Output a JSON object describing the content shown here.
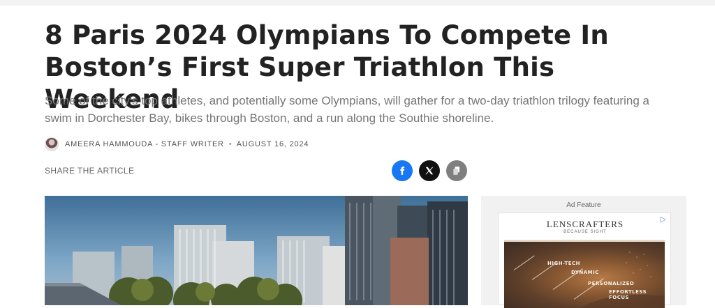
{
  "article": {
    "title": "8 Paris 2024 Olympians To Compete In Boston’s First Super Triathlon This Weekend",
    "subtitle": "Some of the city's top athletes, and potentially some Olympians, will gather for a two-day triathlon trilogy featuring a swim in Dorchester Bay, bikes through Boston, and a run along the Southie shoreline.",
    "author": "AMEERA HAMMOUDA - STAFF WRITER",
    "date": "AUGUST 16, 2024",
    "separator": "•"
  },
  "share": {
    "label": "SHARE THE ARTICLE",
    "buttons": [
      {
        "name": "facebook",
        "icon": "facebook-icon",
        "color": "#1877f2"
      },
      {
        "name": "x",
        "icon": "x-icon",
        "color": "#111111"
      },
      {
        "name": "copy-link",
        "icon": "copy-icon",
        "color": "#7f7f7f"
      }
    ]
  },
  "ad": {
    "label": "Ad Feature",
    "brand": "LENSCRAFTERS",
    "tagline": "BECAUSE SIGHT",
    "features": [
      "HIGH-TECH",
      "DYNAMIC",
      "PERSONALIZED",
      "EFFORTLESS FOCUS"
    ]
  }
}
